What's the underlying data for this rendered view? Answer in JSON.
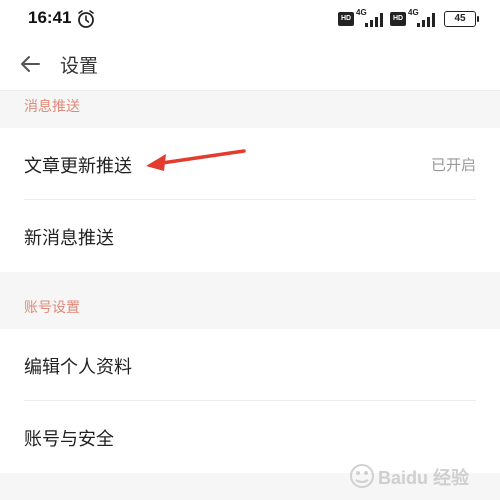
{
  "status_bar": {
    "time": "16:41",
    "hd1": "HD",
    "net1": "4G",
    "hd2": "HD",
    "net2": "4G",
    "battery": "45"
  },
  "header": {
    "title": "设置"
  },
  "sections": {
    "push": {
      "label": "消息推送",
      "article_update": {
        "label": "文章更新推送",
        "value": "已开启"
      },
      "new_message": {
        "label": "新消息推送"
      }
    },
    "account": {
      "label": "账号设置",
      "edit_profile": {
        "label": "编辑个人资料"
      },
      "account_security": {
        "label": "账号与安全"
      }
    }
  },
  "icons": {
    "back": "back-arrow-icon",
    "alarm": "alarm-icon",
    "annotation": "red-arrow-annotation",
    "watermark": "baidu-jingyan-watermark"
  },
  "watermark_text": "Baidu 经验",
  "colors": {
    "accent_section": "#e08a7a",
    "annotation_red": "#e43b2f",
    "value_gray": "#999999"
  }
}
